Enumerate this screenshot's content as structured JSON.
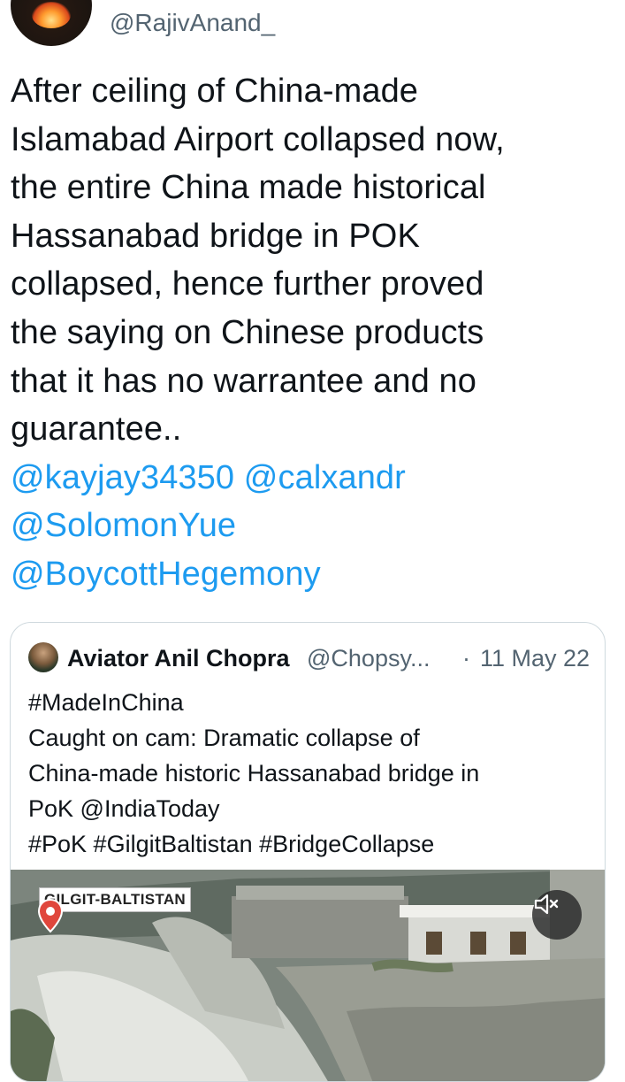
{
  "author": {
    "handle": "@RajivAnand_",
    "avatar_icon": "flame-avatar"
  },
  "tweet": {
    "lines": [
      "After ceiling of China-made",
      "Islamabad Airport collapsed now,",
      "the entire China made historical",
      "Hassanabad bridge in POK",
      "collapsed, hence further proved",
      "the saying on Chinese products",
      "that it has no warrantee and no",
      "guarantee.."
    ],
    "mention_lines": [
      "@kayjay34350 @calxandr",
      "@SolomonYue",
      "@BoycottHegemony"
    ]
  },
  "quoted": {
    "name": "Aviator Anil Chopra",
    "username": "@Chopsy...",
    "separator": "·",
    "date": "11 May 22",
    "lines": [
      "#MadeInChina",
      "Caught on cam: Dramatic collapse of",
      "China-made historic Hassanabad bridge in",
      "PoK @IndiaToday",
      "#PoK #GilgitBaltistan #BridgeCollapse"
    ],
    "media": {
      "location_label": "GILGIT-BALTISTAN",
      "pin_icon": "location-pin-icon",
      "mute_icon": "volume-muted-icon"
    }
  },
  "colors": {
    "link": "#1d9bf0",
    "secondary": "#536471",
    "text": "#0f1419",
    "border": "#cfd9de",
    "pin": "#e0463c"
  }
}
